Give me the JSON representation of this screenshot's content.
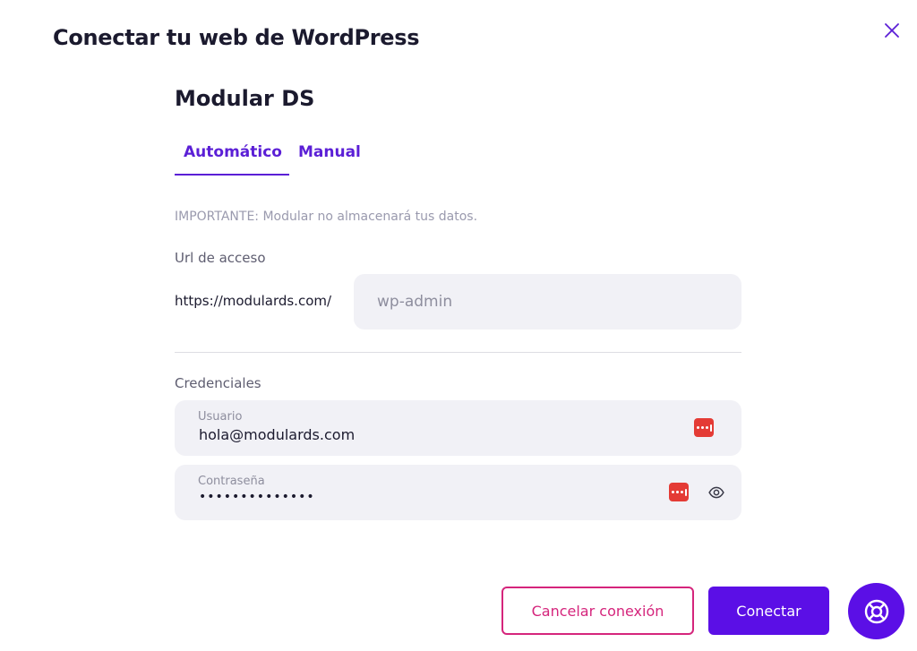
{
  "dialog": {
    "title": "Conectar tu web de WordPress",
    "close_icon": "close-icon"
  },
  "site": {
    "name": "Modular DS"
  },
  "tabs": [
    {
      "label": "Automático",
      "active": true
    },
    {
      "label": "Manual",
      "active": false
    }
  ],
  "notice": "IMPORTANTE: Modular no almacenará tus datos.",
  "access_url": {
    "label": "Url de acceso",
    "prefix": "https://modulards.com/",
    "placeholder": "wp-admin"
  },
  "credentials": {
    "label": "Credenciales",
    "username": {
      "label": "Usuario",
      "value": "hola@modulards.com"
    },
    "password": {
      "label": "Contraseña",
      "value": "••••••••••••••"
    }
  },
  "actions": {
    "cancel_label": "Cancelar conexión",
    "connect_label": "Conectar"
  },
  "colors": {
    "primary": "#5b0fe6",
    "accent_pink": "#d5257c",
    "password_manager_red": "#e43b35",
    "field_bg": "#f1f1f6"
  },
  "icons": {
    "close": "close-icon",
    "password_manager": "password-manager-icon",
    "show_password": "eye-icon",
    "help": "lifebuoy-icon"
  }
}
